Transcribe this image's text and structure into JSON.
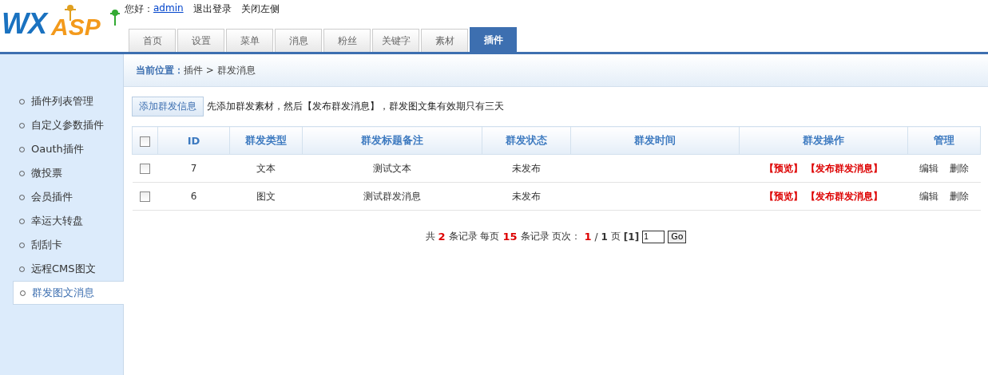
{
  "logo": {
    "part_1": "WX",
    "part_2": "ASP"
  },
  "top_links": {
    "greeting": "您好：",
    "user": "admin",
    "links": [
      "退出登录",
      "关闭左侧"
    ]
  },
  "tabs": [
    {
      "label": "首页",
      "selected": false
    },
    {
      "label": "设置",
      "selected": false
    },
    {
      "label": "菜单",
      "selected": false
    },
    {
      "label": "消息",
      "selected": false
    },
    {
      "label": "粉丝",
      "selected": false
    },
    {
      "label": "关键字",
      "selected": false
    },
    {
      "label": "素材",
      "selected": false
    },
    {
      "label": "插件",
      "selected": true
    }
  ],
  "sidebar": {
    "items": [
      {
        "label": "插件列表管理",
        "selected": false
      },
      {
        "label": "自定义参数插件",
        "selected": false
      },
      {
        "label": "Oauth插件",
        "selected": false
      },
      {
        "label": "微投票",
        "selected": false
      },
      {
        "label": "会员插件",
        "selected": false
      },
      {
        "label": "幸运大转盘",
        "selected": false
      },
      {
        "label": "刮刮卡",
        "selected": false
      },
      {
        "label": "远程CMS图文",
        "selected": false
      },
      {
        "label": "群发图文消息",
        "selected": true
      }
    ]
  },
  "breadcrumb": {
    "label": "当前位置：",
    "path": "插件 > 群发消息"
  },
  "toolbar": {
    "button": "添加群发信息",
    "hint": "先添加群发素材，然后【发布群发消息】，群发图文集有效期只有三天"
  },
  "table": {
    "select_all": {
      "checked": false
    },
    "columns": [
      "ID",
      "群发类型",
      "群发标题备注",
      "群发状态",
      "群发时间",
      "群发操作",
      "管理"
    ],
    "rows": [
      {
        "checked": false,
        "id": "7",
        "type": "文本",
        "title": "测试文本",
        "status": "未发布",
        "time_sent": "",
        "actions": [
          "【预览】",
          "【发布群发消息】"
        ],
        "manage": [
          "编辑",
          "删除"
        ]
      },
      {
        "checked": false,
        "id": "6",
        "type": "图文",
        "title": "测试群发消息",
        "status": "未发布",
        "time_sent": "",
        "actions": [
          "【预览】",
          "【发布群发消息】"
        ],
        "manage": [
          "编辑",
          "删除"
        ]
      }
    ]
  },
  "pagination": {
    "segments": [
      {
        "text": "共",
        "kind": "plain"
      },
      {
        "text": "2",
        "kind": "red"
      },
      {
        "text": "条记录 每页",
        "kind": "plain"
      },
      {
        "text": "15",
        "kind": "red"
      },
      {
        "text": "条记录 页次：",
        "kind": "plain"
      },
      {
        "text": "1",
        "kind": "red"
      },
      {
        "text": "/",
        "kind": "plain"
      },
      {
        "text": "1",
        "kind": "bold"
      },
      {
        "text": "页",
        "kind": "plain"
      },
      {
        "text": "[1]",
        "kind": "bold"
      }
    ],
    "page_input": "1",
    "go_button": "Go"
  }
}
